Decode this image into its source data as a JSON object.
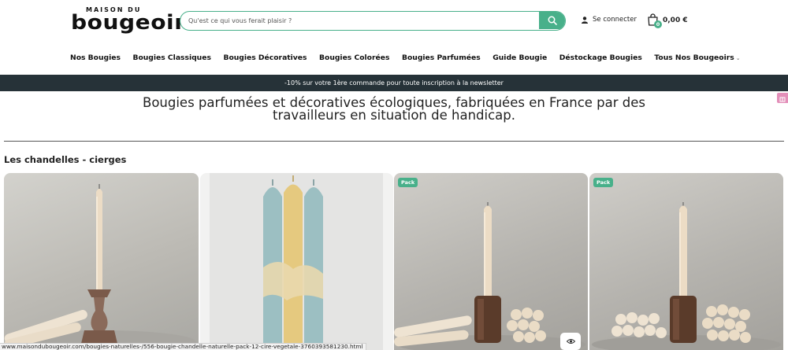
{
  "header": {
    "logo_top": "MAISON DU",
    "logo_main": "bougeoir",
    "search_placeholder": "Qu'est ce qui vous ferait plaisir ?",
    "account_label": "Se connecter",
    "cart_count": "0",
    "cart_amount": "0,00 €"
  },
  "nav": {
    "items": [
      "Nos Bougies",
      "Bougies Classiques",
      "Bougies Décoratives",
      "Bougies Colorées",
      "Bougies Parfumées",
      "Guide Bougie",
      "Déstockage Bougies",
      "Tous Nos Bougeoirs"
    ]
  },
  "promo": {
    "text": "-10% sur votre 1ère commande pour toute inscription à la newsletter"
  },
  "main": {
    "tagline": "Bougies parfumées et décoratives écologiques, fabriquées en France par des travailleurs en situation de handicap.",
    "section_title": "Les chandelles - cierges"
  },
  "products": [
    {
      "badge": ""
    },
    {
      "badge": ""
    },
    {
      "badge": "Pack"
    },
    {
      "badge": "Pack"
    }
  ],
  "status_bar": {
    "url": "www.maisondubougeoir.com/bougies-naturelles-/556-bougie-chandelle-naturelle-pack-12-cire-vegetale-3760393581230.html"
  },
  "colors": {
    "accent": "#48b08a",
    "promo_bg": "#263238",
    "side_badge": "#e38fb9"
  },
  "icons": {
    "search": "search-icon",
    "account": "user-icon",
    "cart": "shopping-bag-icon",
    "quick_view": "eye-icon"
  }
}
